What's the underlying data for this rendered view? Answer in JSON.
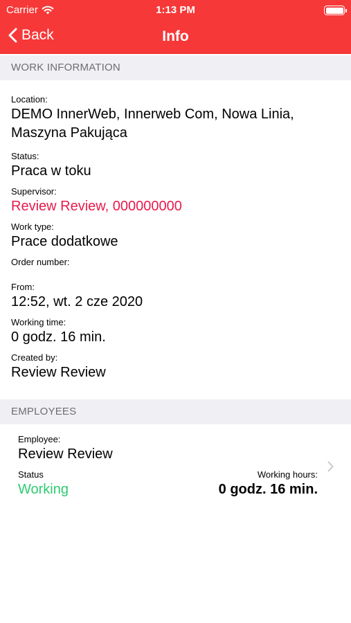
{
  "status_bar": {
    "carrier": "Carrier",
    "time": "1:13 PM"
  },
  "nav": {
    "back_label": "Back",
    "title": "Info"
  },
  "work_info": {
    "header": "WORK INFORMATION",
    "location_label": "Location:",
    "location_line1": "DEMO InnerWeb, Innerweb Com, Nowa Linia,",
    "location_line2": "Maszyna Pakująca",
    "status_label": "Status:",
    "status_value": "Praca w toku",
    "supervisor_label": "Supervisor:",
    "supervisor_value": "Review Review, 000000000",
    "work_type_label": "Work type:",
    "work_type_value": "Prace dodatkowe",
    "order_number_label": "Order number:",
    "from_label": "From:",
    "from_value": "12:52, wt. 2 cze 2020",
    "working_time_label": "Working time:",
    "working_time_value": "0 godz. 16 min.",
    "created_by_label": "Created by:",
    "created_by_value": "Review Review"
  },
  "employees": {
    "header": "EMPLOYEES",
    "items": [
      {
        "employee_label": "Employee:",
        "employee_name": "Review Review",
        "status_label": "Status",
        "status_value": "Working",
        "hours_label": "Working hours:",
        "hours_value": "0 godz. 16 min."
      }
    ]
  },
  "colors": {
    "accent": "#f73838",
    "link": "#e8194b",
    "working": "#2ecc71",
    "section_bg": "#efeff4"
  }
}
